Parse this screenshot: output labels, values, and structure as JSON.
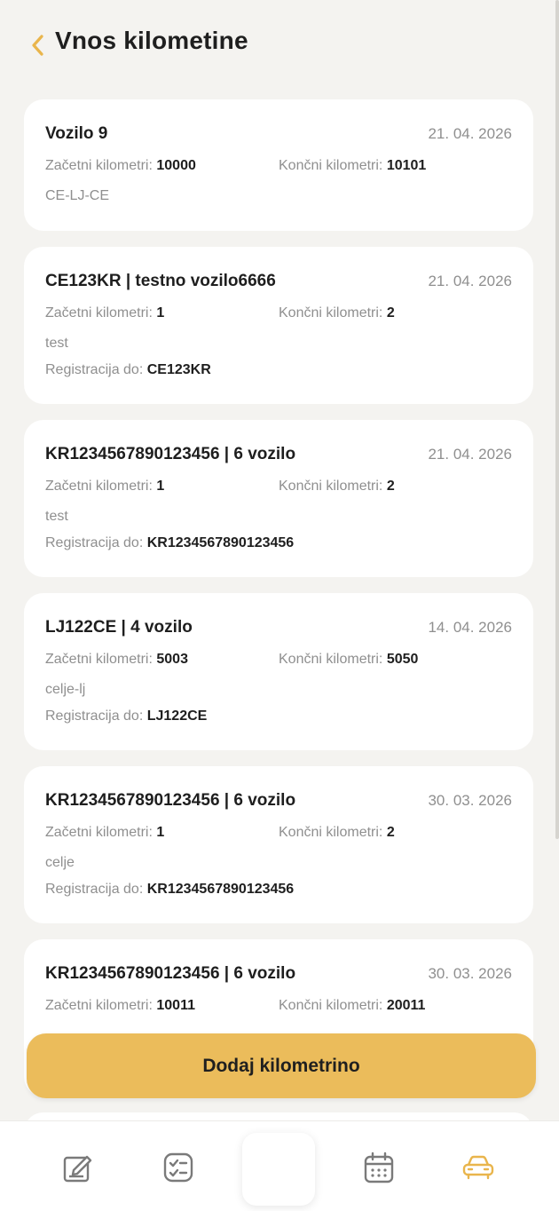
{
  "header": {
    "title": "Vnos kilometine",
    "back_icon": "chevron-left-icon"
  },
  "labels": {
    "start_km": "Začetni kilometri: ",
    "end_km": "Končni kilometri: ",
    "registration": "Registracija do: "
  },
  "entries": [
    {
      "title": "Vozilo 9",
      "date": "21. 04. 2026",
      "start_km": "10000",
      "end_km": "10101",
      "note": "CE-LJ-CE",
      "registration": ""
    },
    {
      "title": "CE123KR | testno vozilo6666",
      "date": "21. 04. 2026",
      "start_km": "1",
      "end_km": "2",
      "note": "test",
      "registration": "CE123KR"
    },
    {
      "title": "KR1234567890123456 | 6 vozilo",
      "date": "21. 04. 2026",
      "start_km": "1",
      "end_km": "2",
      "note": "test",
      "registration": "KR1234567890123456"
    },
    {
      "title": "LJ122CE | 4 vozilo",
      "date": "14. 04. 2026",
      "start_km": "5003",
      "end_km": "5050",
      "note": "celje-lj",
      "registration": "LJ122CE"
    },
    {
      "title": "KR1234567890123456 | 6 vozilo",
      "date": "30. 03. 2026",
      "start_km": "1",
      "end_km": "2",
      "note": "celje",
      "registration": "KR1234567890123456"
    },
    {
      "title": "KR1234567890123456 | 6 vozilo",
      "date": "30. 03. 2026",
      "start_km": "10011",
      "end_km": "20011",
      "note": "",
      "registration": ""
    }
  ],
  "add_button": {
    "label": "Dodaj kilometrino"
  },
  "bottom_nav": {
    "items": [
      {
        "icon": "edit-icon",
        "active": false
      },
      {
        "icon": "checklist-icon",
        "active": false
      },
      {
        "icon": "calendar-icon",
        "active": false
      },
      {
        "icon": "car-icon",
        "active": true
      }
    ]
  },
  "colors": {
    "accent": "#ebbc5b",
    "active_icon": "#e9b54c",
    "inactive_icon": "#7a7a7a",
    "background": "#f4f3f0"
  }
}
